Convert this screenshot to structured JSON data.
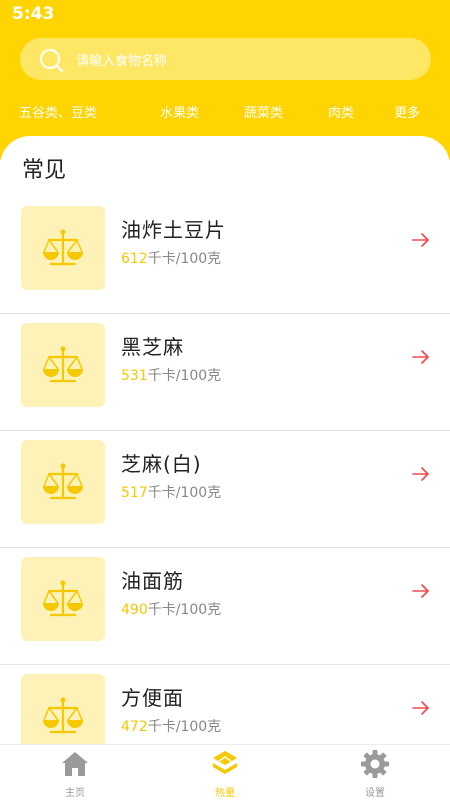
{
  "status_bar": {
    "time": "5:43"
  },
  "search": {
    "placeholder": "请输入食物名称"
  },
  "categories": [
    "五谷类、豆类",
    "水果类",
    "蔬菜类",
    "肉类",
    "更多"
  ],
  "section_title": "常见",
  "foods": [
    {
      "name": "油炸土豆片",
      "calories": "612",
      "unit": "千卡/100克"
    },
    {
      "name": "黑芝麻",
      "calories": "531",
      "unit": "千卡/100克"
    },
    {
      "name": "芝麻(白)",
      "calories": "517",
      "unit": "千卡/100克"
    },
    {
      "name": "油面筋",
      "calories": "490",
      "unit": "千卡/100克"
    },
    {
      "name": "方便面",
      "calories": "472",
      "unit": "千卡/100克"
    }
  ],
  "tabs": [
    {
      "label": "主页",
      "icon": "home-icon",
      "active": false
    },
    {
      "label": "热量",
      "icon": "layers-icon",
      "active": true
    },
    {
      "label": "设置",
      "icon": "gear-icon",
      "active": false
    }
  ],
  "colors": {
    "accent": "#FFD400",
    "calorie_number": "#F5C800",
    "arrow": "#F04848",
    "thumb_bg": "#FFF2B8"
  }
}
